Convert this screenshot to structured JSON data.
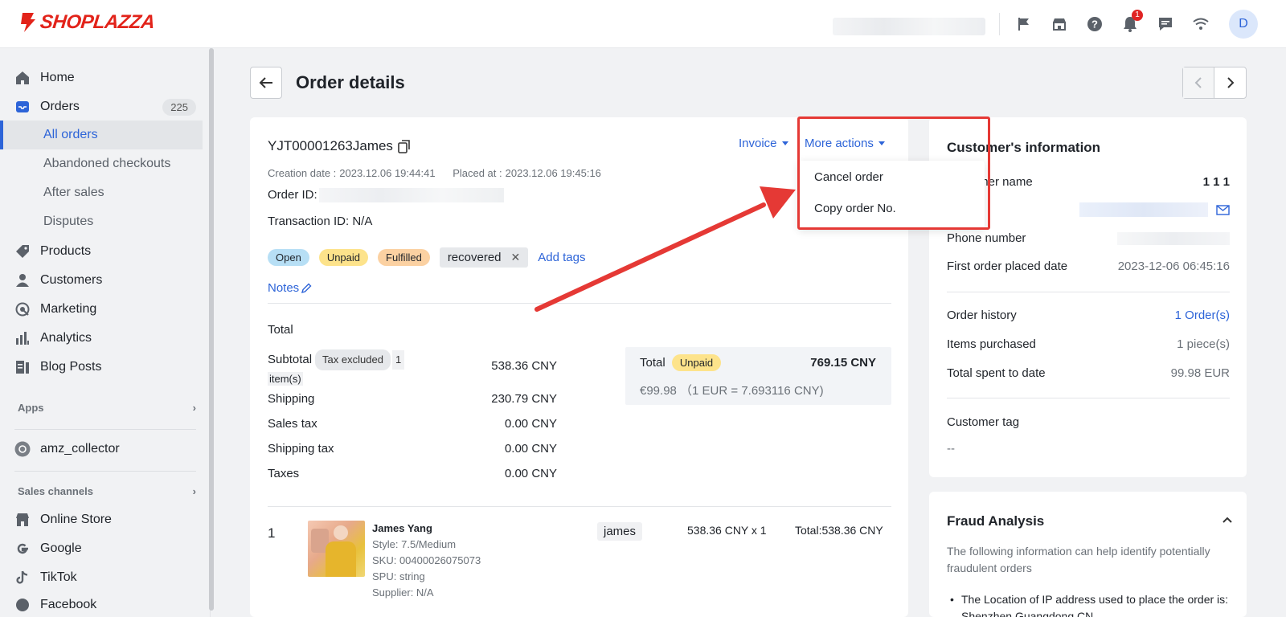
{
  "brand": {
    "name": "SHOPLAZZA",
    "accent": "#2d64d8",
    "brand_red": "#e2231a"
  },
  "topbar": {
    "icons": [
      "flag-icon",
      "store-icon",
      "help-icon",
      "bell-icon",
      "chat-icon",
      "wifi-icon"
    ],
    "notification_count": "1",
    "avatar_letter": "D"
  },
  "sidebar": {
    "home": "Home",
    "orders": "Orders",
    "orders_count": "225",
    "sub": [
      "All orders",
      "Abandoned checkouts",
      "After sales",
      "Disputes"
    ],
    "products": "Products",
    "customers": "Customers",
    "marketing": "Marketing",
    "analytics": "Analytics",
    "blog_posts": "Blog Posts",
    "apps_label": "Apps",
    "app_item": "amz_collector",
    "sales_channels_label": "Sales channels",
    "channels": [
      "Online Store",
      "Google",
      "TikTok",
      "Facebook"
    ]
  },
  "header": {
    "title": "Order details"
  },
  "order": {
    "number": "YJT00001263James",
    "creation_label": "Creation date :",
    "creation_value": "2023.12.06 19:44:41",
    "placed_label": "Placed at :",
    "placed_value": "2023.12.06 19:45:16",
    "order_id_label": "Order ID:",
    "transaction_id": "Transaction ID: N/A",
    "invoice": "Invoice",
    "more_actions": "More actions",
    "tags": {
      "open": "Open",
      "unpaid": "Unpaid",
      "fulfilled": "Fulfilled",
      "custom": "recovered",
      "add": "Add tags"
    },
    "notes": "Notes"
  },
  "dropdown": {
    "options": [
      "Cancel order",
      "Copy order No."
    ]
  },
  "totals": {
    "section_title": "Total",
    "subtotal_label": "Subtotal",
    "tax_pill": "Tax excluded",
    "items_pill": "1",
    "items_suffix": "item(s)",
    "subtotal_value": "538.36 CNY",
    "shipping_label": "Shipping",
    "shipping_value": "230.79 CNY",
    "sales_tax_label": "Sales tax",
    "sales_tax_value": "0.00 CNY",
    "shipping_tax_label": "Shipping tax",
    "shipping_tax_value": "0.00 CNY",
    "taxes_label": "Taxes",
    "taxes_value": "0.00 CNY",
    "box_label": "Total",
    "box_status": "Unpaid",
    "box_value": "769.15 CNY",
    "box_conversion": "€99.98 （1 EUR = 7.693116 CNY)"
  },
  "line_item": {
    "index": "1",
    "name": "James Yang",
    "style": "Style: 7.5/Medium",
    "sku": "SKU: 00400026075073",
    "spu": "SPU: string",
    "supplier": "Supplier: N/A",
    "vendor": "james",
    "price_qty": "538.36 CNY x 1",
    "total": "Total:538.36 CNY"
  },
  "customer": {
    "title": "Customer's information",
    "name_label": "Customer name",
    "name_value": "1 1 1",
    "phone_label": "Phone number",
    "first_order_label": "First order placed date",
    "first_order_value": "2023-12-06 06:45:16",
    "history_label": "Order history",
    "history_value": "1 Order(s)",
    "items_label": "Items purchased",
    "items_value": "1 piece(s)",
    "spent_label": "Total spent to date",
    "spent_value": "99.98 EUR",
    "tag_label": "Customer tag",
    "tag_value": "--"
  },
  "fraud": {
    "title": "Fraud Analysis",
    "intro": "The following information can help identify potentially fraudulent orders",
    "bullet": "The Location of IP address used to place the order is: Shenzhen,Guangdong,CN"
  }
}
